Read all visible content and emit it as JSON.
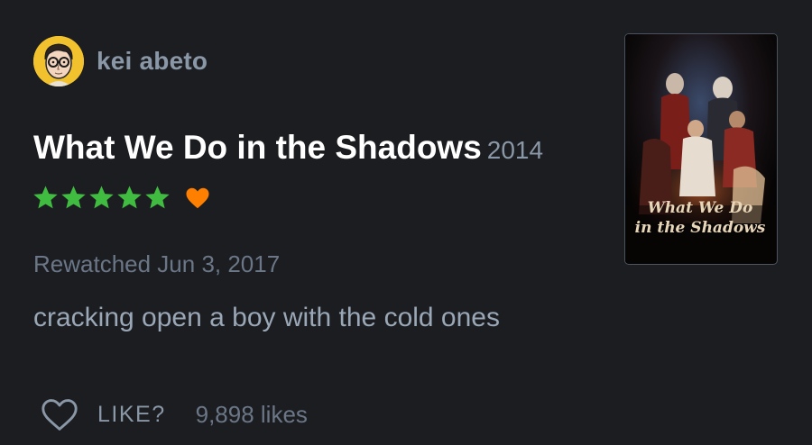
{
  "author": {
    "name": "kei abeto"
  },
  "film": {
    "title": "What We Do in the Shadows",
    "year": "2014",
    "poster_text_line1": "What We Do",
    "poster_text_line2": "in the Shadows"
  },
  "rating": {
    "stars": 5,
    "liked": true,
    "star_color": "#40bc40",
    "heart_color": "#ff8000"
  },
  "watched": {
    "text": "Rewatched Jun 3, 2017"
  },
  "review": {
    "body": "cracking open a boy with the cold ones"
  },
  "likes": {
    "button_label": "LIKE?",
    "count_text": "9,898 likes"
  },
  "colors": {
    "background": "#1b1d21",
    "muted_text": "#8a97a6",
    "dim_text": "#6b7787"
  }
}
